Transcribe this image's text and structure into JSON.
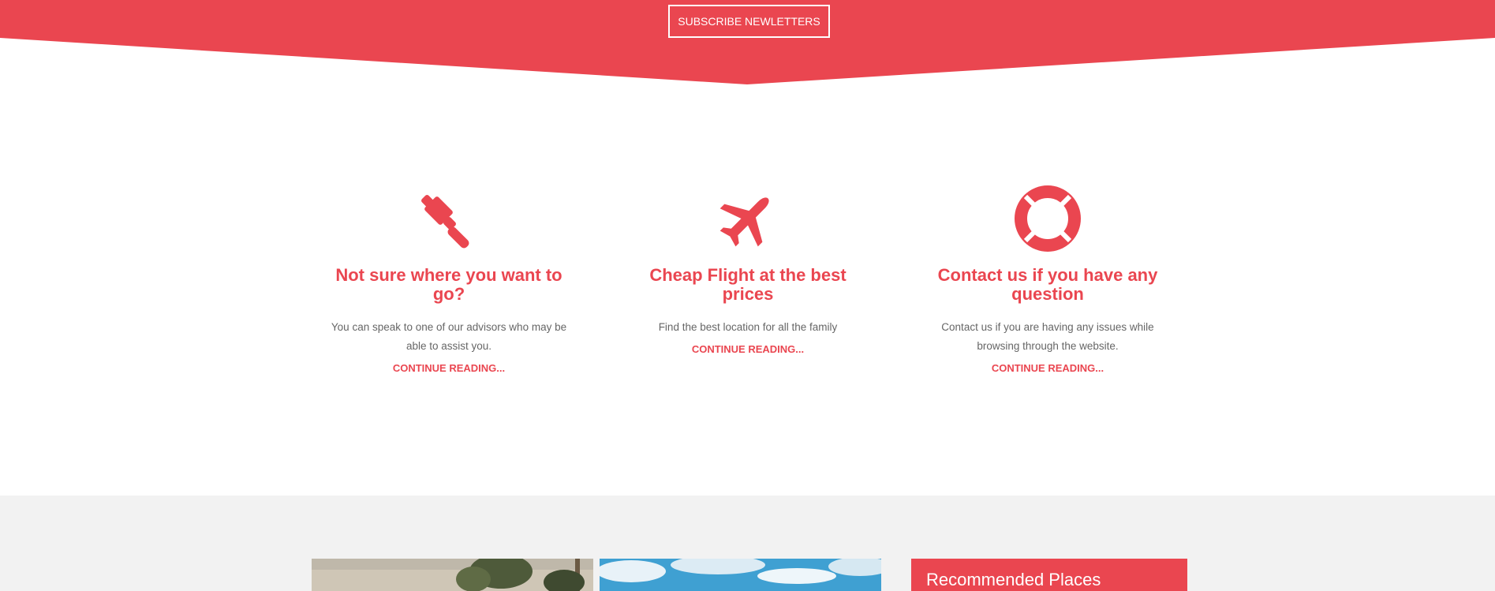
{
  "colors": {
    "accent": "#ea4650",
    "background": "#ffffff",
    "section_gray": "#f2f2f2",
    "body_text": "#666666"
  },
  "subscribe": {
    "label": "SUBSCRIBE NEWLETTERS"
  },
  "features": [
    {
      "icon": "gavel-icon",
      "title": "Not sure where you want to go?",
      "text": "You can speak to one of our advisors who may be able to assist you.",
      "link": "CONTINUE READING..."
    },
    {
      "icon": "plane-icon",
      "title": "Cheap Flight at the best prices",
      "text": "Find the best location for all the family",
      "link": "CONTINUE READING..."
    },
    {
      "icon": "life-ring-icon",
      "title": "Contact us if you have any question",
      "text": "Contact us if you are having any issues while browsing through the website.",
      "link": "CONTINUE READING..."
    }
  ],
  "sidebar": {
    "title": "Recommended Places"
  }
}
